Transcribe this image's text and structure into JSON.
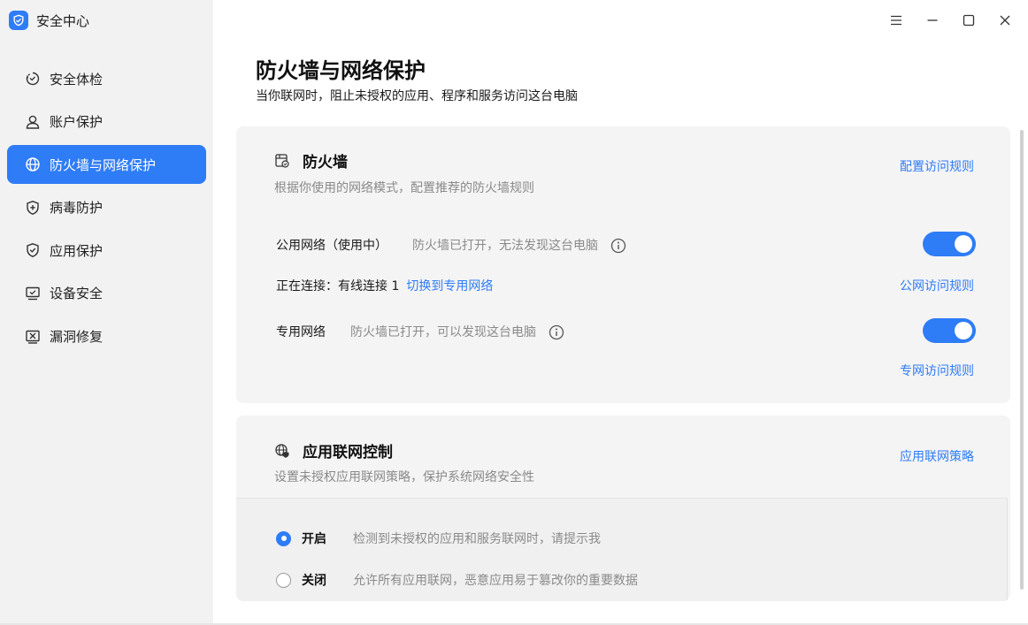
{
  "app": {
    "title": "安全中心",
    "logo_icon": "shield-logo-icon",
    "accent": "#2e7cf6"
  },
  "sidebar": {
    "items": [
      {
        "label": "安全体检",
        "icon": "checkup-icon",
        "active": false
      },
      {
        "label": "账户保护",
        "icon": "user-icon",
        "active": false
      },
      {
        "label": "防火墙与网络保护",
        "icon": "globe-icon",
        "active": true
      },
      {
        "label": "病毒防护",
        "icon": "shield-plus-icon",
        "active": false
      },
      {
        "label": "应用保护",
        "icon": "shield-check-icon",
        "active": false
      },
      {
        "label": "设备安全",
        "icon": "monitor-check-icon",
        "active": false
      },
      {
        "label": "漏洞修复",
        "icon": "bug-fix-icon",
        "active": false
      }
    ]
  },
  "window": {
    "menu_icon": "menu-icon",
    "minimize_icon": "minimize-icon",
    "maximize_icon": "maximize-icon",
    "close_icon": "close-icon"
  },
  "header": {
    "title": "防火墙与网络保护",
    "subtitle": "当你联网时，阻止未授权的应用、程序和服务访问这台电脑"
  },
  "firewall": {
    "title": "防火墙",
    "desc": "根据你使用的网络模式，配置推荐的防火墙规则",
    "config_link": "配置访问规则",
    "public": {
      "label": "公用网络（使用中）",
      "status": "防火墙已打开，无法发现这台电脑",
      "enabled": true,
      "rules_link": "公网访问规则"
    },
    "connection": {
      "label": "正在连接：有线连接 1",
      "switch_link": "切换到专用网络"
    },
    "private": {
      "label": "专用网络",
      "status": "防火墙已打开，可以发现这台电脑",
      "enabled": true,
      "rules_link": "专网访问规则"
    }
  },
  "app_control": {
    "title": "应用联网控制",
    "desc": "设置未授权应用联网策略，保护系统网络安全性",
    "policy_link": "应用联网策略",
    "options": [
      {
        "label": "开启",
        "desc": "检测到未授权的应用和服务联网时，请提示我",
        "selected": true
      },
      {
        "label": "关闭",
        "desc": "允许所有应用联网，恶意应用易于篡改你的重要数据",
        "selected": false
      }
    ]
  }
}
